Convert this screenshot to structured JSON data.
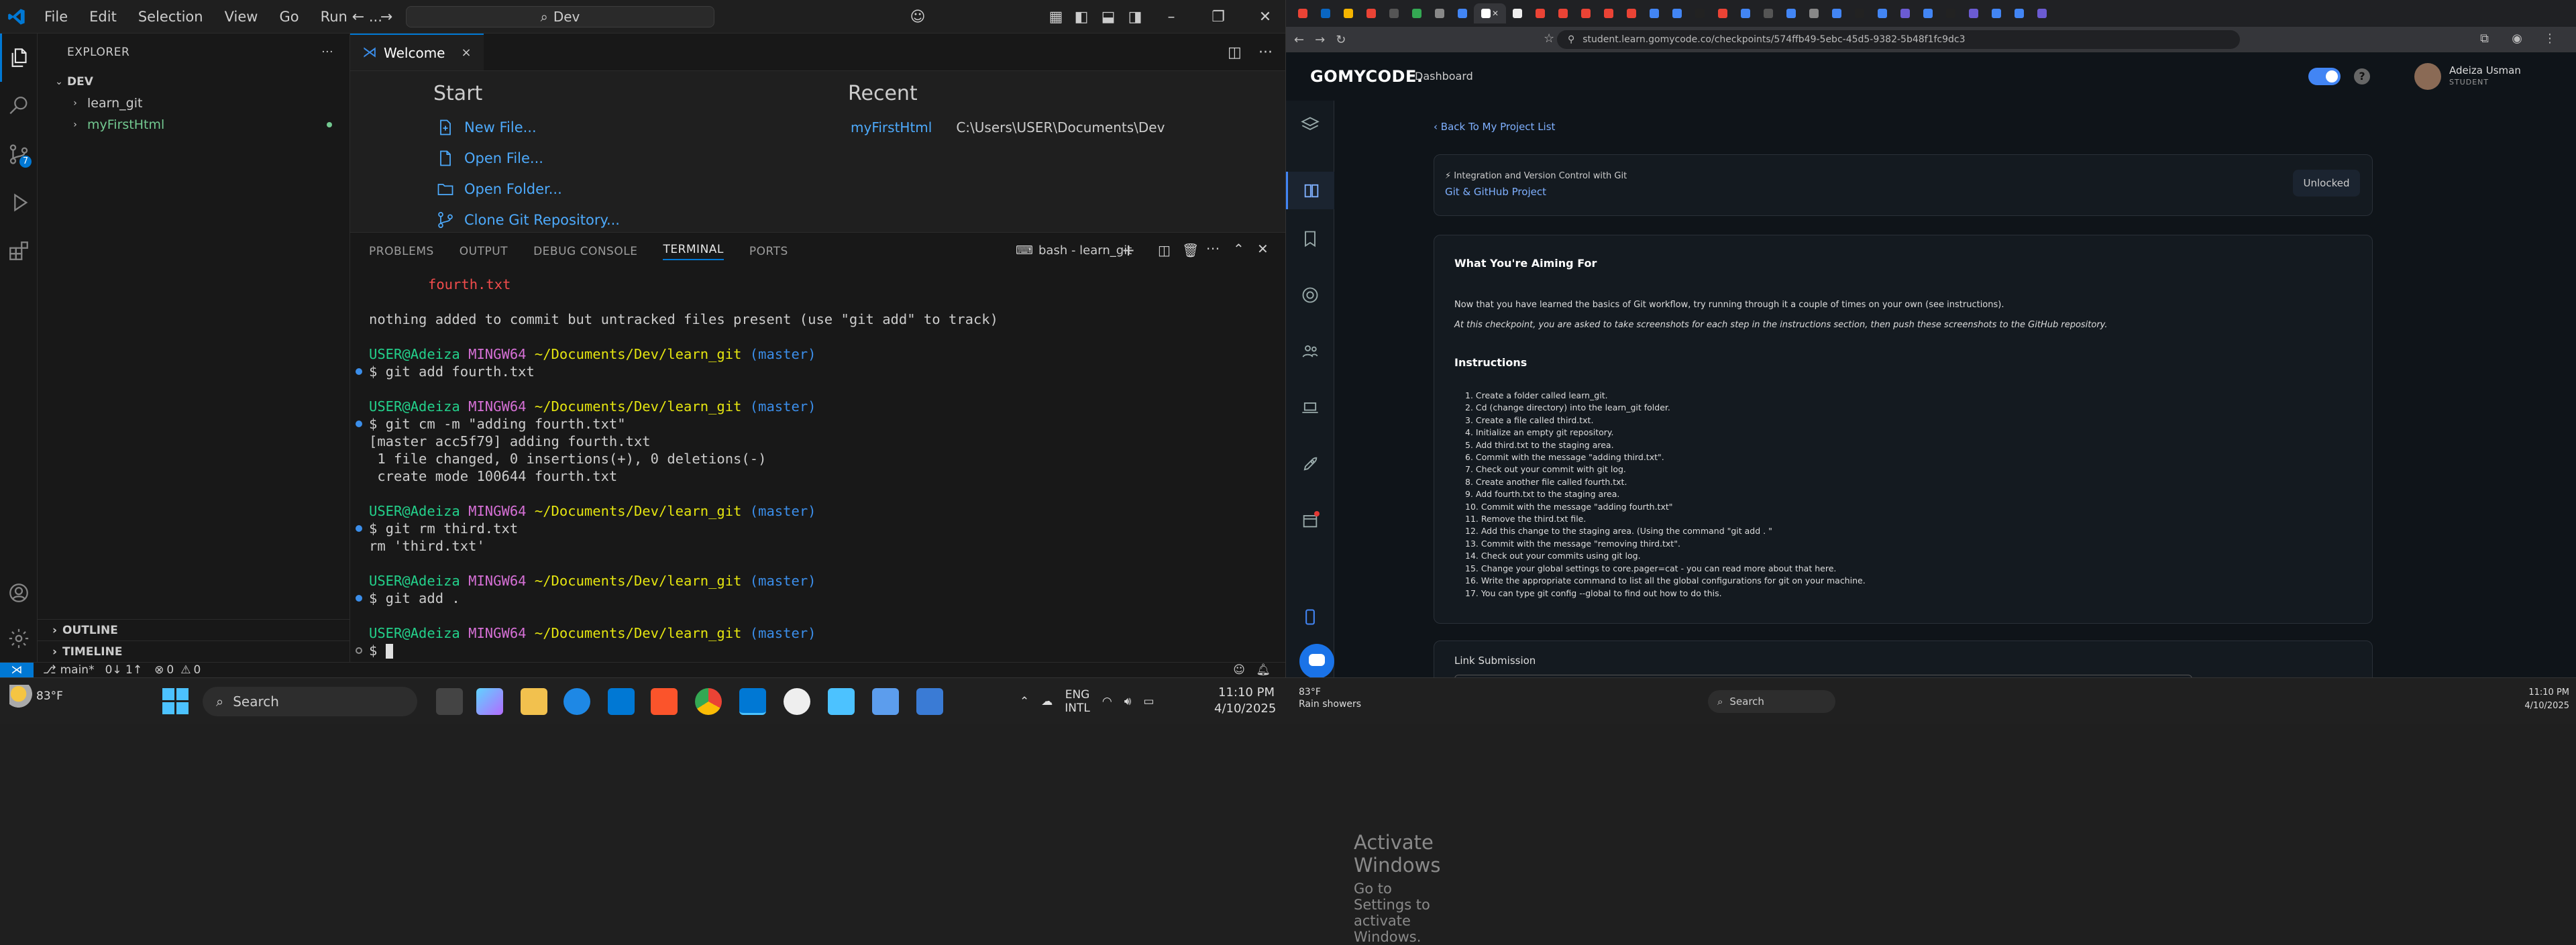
{
  "vscode": {
    "menu": [
      "File",
      "Edit",
      "Selection",
      "View",
      "Go",
      "Run",
      "..."
    ],
    "command_center": "Dev",
    "explorer_title": "EXPLORER",
    "folder": "DEV",
    "tree": [
      {
        "label": "learn_git",
        "color": "#cccccc"
      },
      {
        "label": "myFirstHtml",
        "color": "#73c991"
      }
    ],
    "outline": "OUTLINE",
    "timeline": "TIMELINE",
    "source_control_badge": "7",
    "tab": {
      "label": "Welcome",
      "close": "×"
    },
    "welcome": {
      "start_heading": "Start",
      "recent_heading": "Recent",
      "links": [
        "New File...",
        "Open File...",
        "Open Folder...",
        "Clone Git Repository..."
      ],
      "recent": [
        {
          "name": "myFirstHtml",
          "path": "C:\\Users\\USER\\Documents\\Dev"
        }
      ]
    },
    "panel_tabs": [
      "PROBLEMS",
      "OUTPUT",
      "DEBUG CONSOLE",
      "TERMINAL",
      "PORTS"
    ],
    "terminal_name": "bash - learn_git",
    "terminal": {
      "l1": "fourth.txt",
      "l2": "nothing added to commit but untracked files present (use \"git add\" to track)",
      "user": "USER@Adeiza",
      "mingw": "MINGW64",
      "path": "~/Documents/Dev/learn_git",
      "branch": "(master)",
      "c1": "$ git add fourth.txt",
      "c2": "$ git cm -m \"adding fourth.txt\"",
      "o2a": "[master acc5f79] adding fourth.txt",
      "o2b": " 1 file changed, 0 insertions(+), 0 deletions(-)",
      "o2c": " create mode 100644 fourth.txt",
      "c3": "$ git rm third.txt",
      "o3": "rm 'third.txt'",
      "c4": "$ git add .",
      "prompt": "$ "
    },
    "activate": {
      "title": "Activate Windows",
      "sub": "Go to Settings to activate Windows."
    },
    "status": {
      "branch": "main*",
      "sync": "0↓ 1↑",
      "errors": "0",
      "warnings": "0"
    }
  },
  "browser": {
    "url": "student.learn.gomycode.co/checkpoints/574ffb49-5ebc-45d5-9382-5b48f1fc9dc3",
    "brand": "GOMYCODE.",
    "nav": "Dashboard",
    "user": {
      "name": "Adeiza Usman",
      "role": "STUDENT"
    },
    "back": "Back To My Project List",
    "module": "Integration and Version Control with Git",
    "project": "Git & GitHub Project",
    "unlocked": "Unlocked",
    "aim_heading": "What You're Aiming For",
    "aim_p1": "Now that you have learned the basics of Git workflow, try running through it a couple of times on your own (see instructions).",
    "aim_p2": "At this checkpoint, you are asked to take screenshots for each step in the instructions section, then push these screenshots to the GitHub repository.",
    "instr_heading": "Instructions",
    "steps": [
      "1. Create a folder called learn_git.",
      "2. Cd (change directory) into the learn_git folder.",
      "3. Create a file called third.txt.",
      "4. Initialize an empty git repository.",
      "5. Add third.txt to the staging area.",
      "6. Commit with the message \"adding third.txt\".",
      "7. Check out your commit with git log.",
      "8. Create another file called fourth.txt.",
      "9. Add fourth.txt to the staging area.",
      "10. Commit with the message \"adding fourth.txt\"",
      "11. Remove the third.txt file.",
      "12. Add this change to the staging area. (Using the command \"git add . \"",
      "13. Commit with the message \"removing third.txt\".",
      "14. Check out your commits using git log.",
      "15. Change your global settings to core.pager=cat - you can read more about that here.",
      "16. Write the appropriate command to list all the global configurations for git on your machine.",
      "17. You can type git config --global to find out how to do this."
    ],
    "link_submission": "Link Submission"
  },
  "taskbar": {
    "temp": "83°F",
    "search": "Search",
    "lang1": "ENG",
    "lang2": "INTL",
    "time": "11:10 PM",
    "date": "4/10/2025",
    "tb2_temp": "83°F",
    "tb2_weather": "Rain showers",
    "tb2_search": "Search",
    "tb2_time": "11:10 PM",
    "tb2_date": "4/10/2025"
  },
  "colors": {
    "accent": "#0078d4",
    "link": "#4daafc",
    "prompt_user": "#23d18b",
    "prompt_mingw": "#d670d6",
    "prompt_path": "#e5e510",
    "prompt_branch": "#3b8eea",
    "untracked": "#f14c4c"
  }
}
